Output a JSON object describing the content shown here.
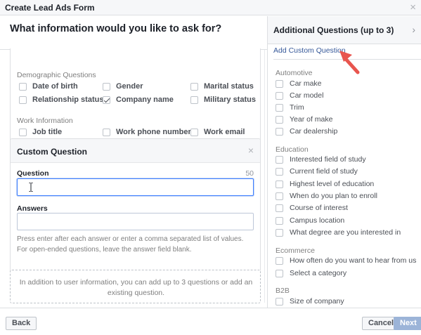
{
  "window": {
    "title": "Create Lead Ads Form",
    "close_glyph": "×"
  },
  "main": {
    "heading": "What information would you like to ask for?",
    "demographic": {
      "label": "Demographic Questions",
      "items": [
        {
          "label": "Date of birth",
          "checked": false
        },
        {
          "label": "Gender",
          "checked": false
        },
        {
          "label": "Marital status",
          "checked": false
        },
        {
          "label": "Relationship status",
          "checked": false
        },
        {
          "label": "Company name",
          "checked": true
        },
        {
          "label": "Military status",
          "checked": false
        }
      ]
    },
    "work": {
      "label": "Work Information",
      "items": [
        {
          "label": "Job title",
          "checked": false
        },
        {
          "label": "Work phone number",
          "checked": false
        },
        {
          "label": "Work email",
          "checked": false
        }
      ]
    },
    "custom_question": {
      "title": "Custom Question",
      "close_glyph": "×",
      "question_label": "Question",
      "char_count": "50",
      "question_value": "",
      "answers_label": "Answers",
      "answers_value": "",
      "help_text": "Press enter after each answer or enter a comma separated list of values. For open-ended questions, leave the answer field blank."
    },
    "add_more_text": "In addition to user information, you can add up to 3 questions or add an existing question."
  },
  "sidebar": {
    "title": "Additional Questions (up to 3)",
    "chevron": "›",
    "add_link": "Add Custom Question",
    "sections": [
      {
        "label": "Automotive",
        "items": [
          "Car make",
          "Car model",
          "Trim",
          "Year of make",
          "Car dealership"
        ]
      },
      {
        "label": "Education",
        "items": [
          "Interested field of study",
          "Current field of study",
          "Highest level of education",
          "When do you plan to enroll",
          "Course of interest",
          "Campus location",
          "What degree are you interested in"
        ]
      },
      {
        "label": "Ecommerce",
        "items": [
          "How often do you want to hear from us",
          "Select a category"
        ]
      },
      {
        "label": "B2B",
        "items": [
          "Size of company"
        ]
      }
    ]
  },
  "footer": {
    "back": "Back",
    "cancel": "Cancel",
    "next": "Next"
  },
  "colors": {
    "link": "#365899",
    "focus": "#4080ff",
    "arrow": "#e8554e",
    "next_disabled": "#9cb4d8"
  },
  "icons": {
    "pointer_arrow": "arrow-icon",
    "text_cursor": "ibeam-cursor-icon",
    "checkmark": "check-icon"
  }
}
